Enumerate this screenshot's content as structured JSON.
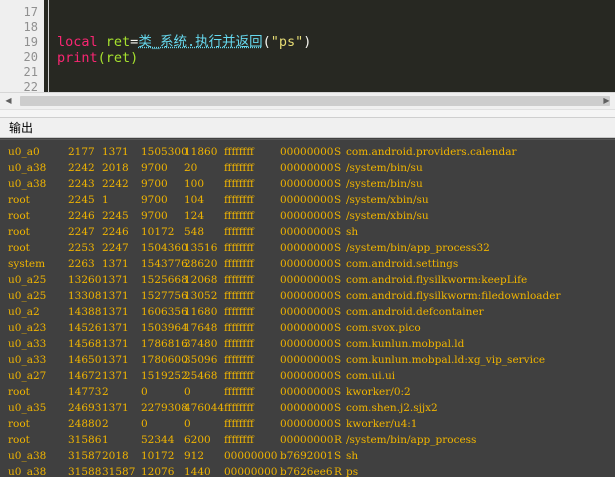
{
  "editor": {
    "line_numbers": [
      "17",
      "18",
      "19",
      "20",
      "21",
      "22"
    ],
    "code_lines": [
      {
        "tokens": []
      },
      {
        "tokens": []
      },
      {
        "tokens": [
          {
            "text": "local ",
            "color": "#f92672"
          },
          {
            "text": "ret",
            "color": "#a6e22e"
          },
          {
            "text": "=",
            "color": "#f8f8f2"
          },
          {
            "text": "类_系统.执行并返回",
            "color": "#66d9ef"
          },
          {
            "text": "(",
            "color": "#f8f8f2"
          },
          {
            "text": "\"ps\"",
            "color": "#e6db74"
          },
          {
            "text": ")",
            "color": "#f8f8f2"
          }
        ]
      },
      {
        "tokens": [
          {
            "text": "print",
            "color": "#f92672"
          },
          {
            "text": "(ret)",
            "color": "#a6e22e"
          }
        ]
      },
      {
        "tokens": []
      },
      {
        "tokens": []
      }
    ]
  },
  "scrollbar": {
    "left_arrow": "◀",
    "right_arrow": "▶"
  },
  "output": {
    "title": "输出",
    "text_color": "#f0b400",
    "rows": [
      [
        "u0_a0",
        "2177",
        "1371",
        "1505300",
        "11860",
        "ffffffff",
        "00000000",
        "S",
        "com.android.providers.calendar"
      ],
      [
        "u0_a38",
        "2242",
        "2018",
        "9700",
        "20",
        "ffffffff",
        "00000000",
        "S",
        "/system/bin/su"
      ],
      [
        "u0_a38",
        "2243",
        "2242",
        "9700",
        "100",
        "ffffffff",
        "00000000",
        "S",
        "/system/bin/su"
      ],
      [
        "root",
        "2245",
        "1",
        "9700",
        "104",
        "ffffffff",
        "00000000",
        "S",
        "/system/xbin/su"
      ],
      [
        "root",
        "2246",
        "2245",
        "9700",
        "124",
        "ffffffff",
        "00000000",
        "S",
        "/system/xbin/su"
      ],
      [
        "root",
        "2247",
        "2246",
        "10172",
        "548",
        "ffffffff",
        "00000000",
        "S",
        "sh"
      ],
      [
        "root",
        "2253",
        "2247",
        "1504360",
        "13516",
        "ffffffff",
        "00000000",
        "S",
        "/system/bin/app_process32"
      ],
      [
        "system",
        "2263",
        "1371",
        "1543776",
        "28620",
        "ffffffff",
        "00000000",
        "S",
        "com.android.settings"
      ],
      [
        "u0_a25",
        "13260",
        "1371",
        "1525668",
        "12068",
        "ffffffff",
        "00000000",
        "S",
        "com.android.flysilkworm:keepLife"
      ],
      [
        "u0_a25",
        "13308",
        "1371",
        "1527756",
        "13052",
        "ffffffff",
        "00000000",
        "S",
        "com.android.flysilkworm:filedownloader"
      ],
      [
        "u0_a2",
        "14388",
        "1371",
        "1606356",
        "11680",
        "ffffffff",
        "00000000",
        "S",
        "com.android.defcontainer"
      ],
      [
        "u0_a23",
        "14526",
        "1371",
        "1503964",
        "17648",
        "ffffffff",
        "00000000",
        "S",
        "com.svox.pico"
      ],
      [
        "u0_a33",
        "14568",
        "1371",
        "1786816",
        "37480",
        "ffffffff",
        "00000000",
        "S",
        "com.kunlun.mobpal.ld"
      ],
      [
        "u0_a33",
        "14650",
        "1371",
        "1780600",
        "35096",
        "ffffffff",
        "00000000",
        "S",
        "com.kunlun.mobpal.ld:xg_vip_service"
      ],
      [
        "u0_a27",
        "14672",
        "1371",
        "1519252",
        "25468",
        "ffffffff",
        "00000000",
        "S",
        "com.ui.ui"
      ],
      [
        "root",
        "14773",
        "2",
        "0",
        "0",
        "ffffffff",
        "00000000",
        "S",
        "kworker/0:2"
      ],
      [
        "u0_a35",
        "24693",
        "1371",
        "2279308",
        "476044",
        "ffffffff",
        "00000000",
        "S",
        "com.shen.j2.sjjx2"
      ],
      [
        "root",
        "24880",
        "2",
        "0",
        "0",
        "ffffffff",
        "00000000",
        "S",
        "kworker/u4:1"
      ],
      [
        "root",
        "31586",
        "1",
        "52344",
        "6200",
        "ffffffff",
        "00000000",
        "R",
        "/system/bin/app_process"
      ],
      [
        "u0_a38",
        "31587",
        "2018",
        "10172",
        "912",
        "00000000",
        "b7692001",
        "S",
        "sh"
      ],
      [
        "u0_a38",
        "31588",
        "31587",
        "12076",
        "1440",
        "00000000",
        "b7626ee6",
        "R",
        "ps"
      ]
    ]
  }
}
